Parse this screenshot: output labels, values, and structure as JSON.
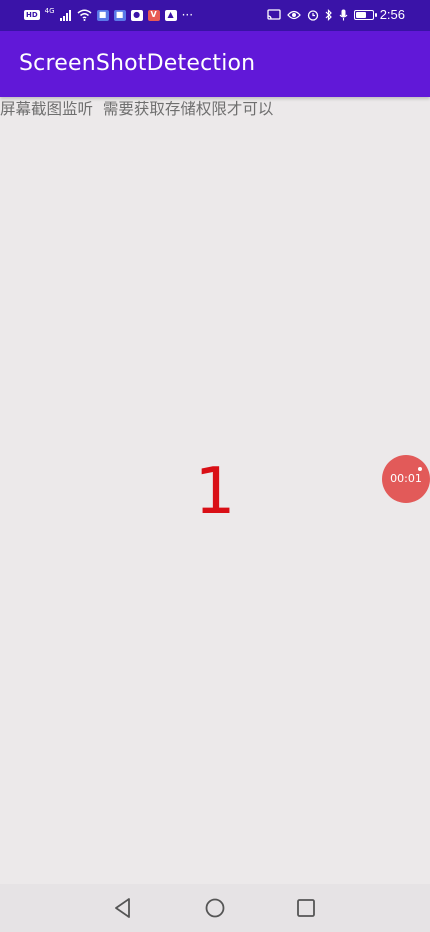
{
  "status_bar": {
    "badge_hd": "HD",
    "network_type": "4G",
    "time": "2:56",
    "battery_level": 0.7,
    "colors": {
      "background": "#3a13a8"
    }
  },
  "app_bar": {
    "title": "ScreenShotDetection",
    "colors": {
      "background": "#6118d8"
    }
  },
  "content": {
    "hint": "屏幕截图监听  需要获取存储权限才可以",
    "counter": "1",
    "counter_color": "#d90f16"
  },
  "recording_bubble": {
    "elapsed": "00:01",
    "color": "#e25a59"
  },
  "nav_bar": {
    "buttons": [
      "back-icon",
      "home-icon",
      "recents-icon"
    ]
  }
}
